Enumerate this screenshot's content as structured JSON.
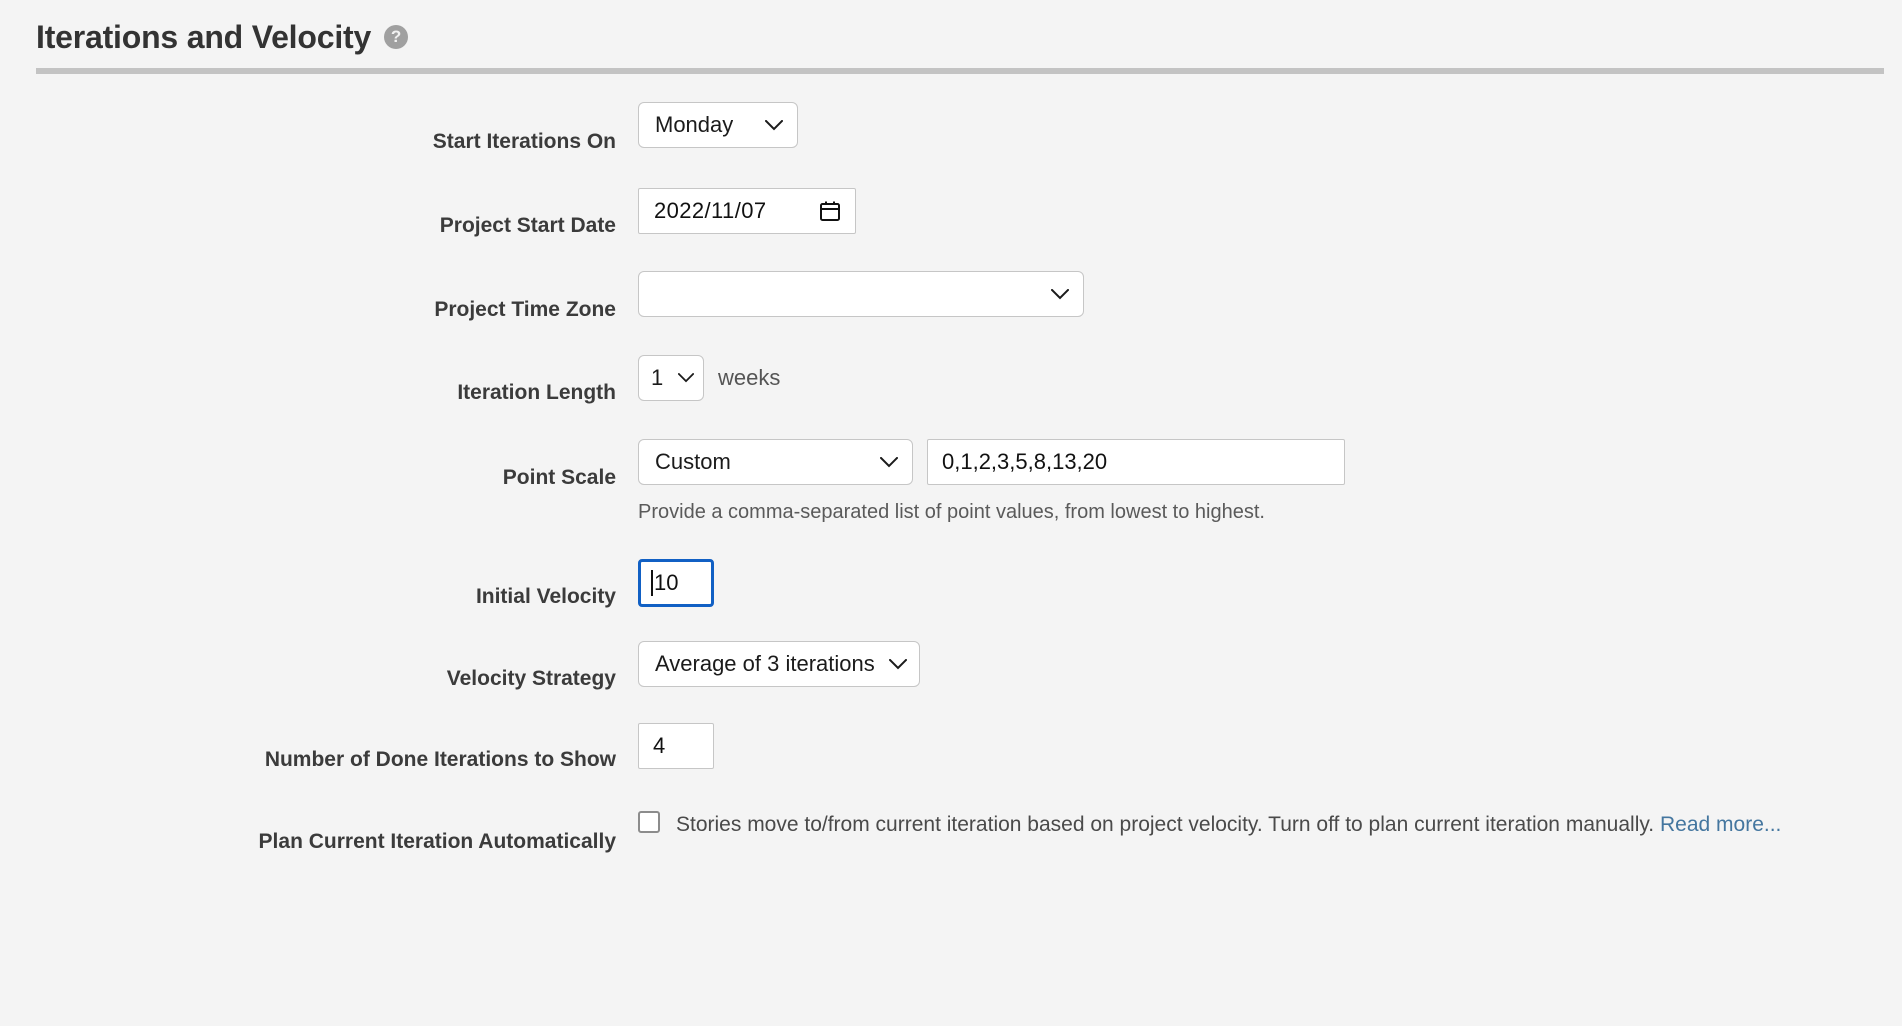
{
  "header": {
    "title": "Iterations and Velocity",
    "help_glyph": "?"
  },
  "form": {
    "start_iterations_on": {
      "label": "Start Iterations On",
      "value": "Monday"
    },
    "project_start_date": {
      "label": "Project Start Date",
      "value": "2022/11/07"
    },
    "project_time_zone": {
      "label": "Project Time Zone",
      "value": ""
    },
    "iteration_length": {
      "label": "Iteration Length",
      "value": "1",
      "suffix": "weeks"
    },
    "point_scale": {
      "label": "Point Scale",
      "value": "Custom",
      "custom_values": "0,1,2,3,5,8,13,20",
      "helper": "Provide a comma-separated list of point values, from lowest to highest."
    },
    "initial_velocity": {
      "label": "Initial Velocity",
      "value": "10"
    },
    "velocity_strategy": {
      "label": "Velocity Strategy",
      "value": "Average of 3 iterations"
    },
    "done_iterations_to_show": {
      "label": "Number of Done Iterations to Show",
      "value": "4"
    },
    "plan_current_iteration": {
      "label": "Plan Current Iteration Automatically",
      "checked": false,
      "description": "Stories move to/from current iteration based on project velocity. Turn off to plan current iteration manually. ",
      "link_text": "Read more..."
    }
  },
  "colors": {
    "page_background": "#f4f4f4",
    "focus_ring": "#1160c4",
    "link": "#44769f",
    "divider": "#c3c3c3",
    "help_icon": "#a0a0a0"
  }
}
